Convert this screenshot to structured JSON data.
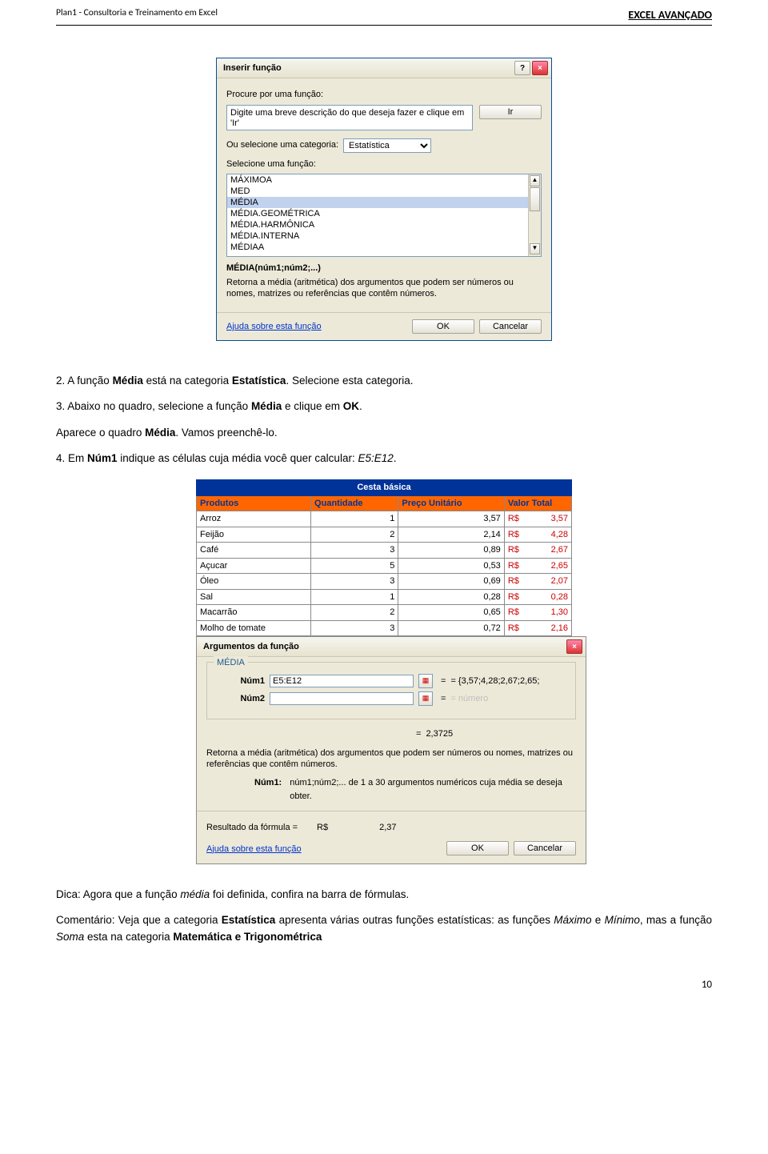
{
  "header": {
    "left": "Plan1 - Consultoria e Treinamento em Excel",
    "right": "EXCEL AVANÇADO"
  },
  "dialog1": {
    "title": "Inserir função",
    "help_btn": "?",
    "close_btn": "×",
    "procure_label": "Procure por uma função:",
    "procure_text": "Digite uma breve descrição do que deseja fazer e clique em 'Ir'",
    "ir_btn": "Ir",
    "categoria_label": "Ou selecione uma categoria:",
    "categoria_value": "Estatística",
    "selecione_label": "Selecione uma função:",
    "functions": [
      "MÁXIMOA",
      "MED",
      "MÉDIA",
      "MÉDIA.GEOMÉTRICA",
      "MÉDIA.HARMÔNICA",
      "MÉDIA.INTERNA",
      "MÉDIAA"
    ],
    "selected_index": 2,
    "syntax": "MÉDIA(núm1;núm2;...)",
    "description": "Retorna a média (aritmética) dos argumentos que podem ser números ou nomes, matrizes ou referências que contêm números.",
    "help_link": "Ajuda sobre esta função",
    "ok": "OK",
    "cancel": "Cancelar"
  },
  "body": {
    "p1a": "2. A função ",
    "p1b": "Média",
    "p1c": " está na categoria ",
    "p1d": "Estatística",
    "p1e": ". Selecione esta categoria.",
    "p2a": "3. Abaixo no quadro, selecione a função ",
    "p2b": "Média",
    "p2c": " e clique em ",
    "p2d": "OK",
    "p2e": ".",
    "p3a": "Aparece o quadro ",
    "p3b": "Média",
    "p3c": ". Vamos preenchê-lo.",
    "p4a": "4. Em ",
    "p4b": "Núm1",
    "p4c": " indique as células cuja média você quer calcular: ",
    "p4d": "E5:E12",
    "p4e": "."
  },
  "sheet": {
    "title": "Cesta básica",
    "headers": [
      "Produtos",
      "Quantidade",
      "Preço Unitário",
      "Valor Total"
    ],
    "rows": [
      {
        "p": "Arroz",
        "q": "1",
        "u": "3,57",
        "c": "R$",
        "t": "3,57"
      },
      {
        "p": "Feijão",
        "q": "2",
        "u": "2,14",
        "c": "R$",
        "t": "4,28"
      },
      {
        "p": "Café",
        "q": "3",
        "u": "0,89",
        "c": "R$",
        "t": "2,67"
      },
      {
        "p": "Açucar",
        "q": "5",
        "u": "0,53",
        "c": "R$",
        "t": "2,65"
      },
      {
        "p": "Óleo",
        "q": "3",
        "u": "0,69",
        "c": "R$",
        "t": "2,07"
      },
      {
        "p": "Sal",
        "q": "1",
        "u": "0,28",
        "c": "R$",
        "t": "0,28"
      },
      {
        "p": "Macarrão",
        "q": "2",
        "u": "0,65",
        "c": "R$",
        "t": "1,30"
      },
      {
        "p": "Molho de tomate",
        "q": "3",
        "u": "0,72",
        "c": "R$",
        "t": "2,16"
      }
    ]
  },
  "dialog2": {
    "title": "Argumentos da função",
    "close_btn": "×",
    "legend": "MÉDIA",
    "num1_lbl": "Núm1",
    "num1_val": "E5:E12",
    "num1_res": "= {3,57;4,28;2,67;2,65;",
    "num2_lbl": "Núm2",
    "num2_val": "",
    "num2_res": "= número",
    "eq_lbl": "=",
    "eq_res": "2,3725",
    "desc": "Retorna a média (aritmética) dos argumentos que podem ser números ou nomes, matrizes ou referências que contêm números.",
    "n1_name": "Núm1:",
    "n1_desc": "núm1;núm2;... de 1 a 30 argumentos numéricos cuja média se deseja obter.",
    "result_lbl": "Resultado da fórmula =",
    "result_cur": "R$",
    "result_val": "2,37",
    "help_link": "Ajuda sobre esta função",
    "ok": "OK",
    "cancel": "Cancelar"
  },
  "body2": {
    "p5a": "Dica: Agora que a função ",
    "p5b": "média",
    "p5c": " foi definida, confira na barra de fórmulas.",
    "p6a": "Comentário: Veja que a categoria ",
    "p6b": "Estatística",
    "p6c": " apresenta várias outras funções estatísticas: as funções ",
    "p6d": "Máximo",
    "p6e": " e ",
    "p6f": "Mínimo",
    "p6g": ", mas a função ",
    "p6h": "Soma",
    "p6i": " esta na categoria ",
    "p6j": "Matemática e Trigonométrica"
  },
  "page_number": "10"
}
